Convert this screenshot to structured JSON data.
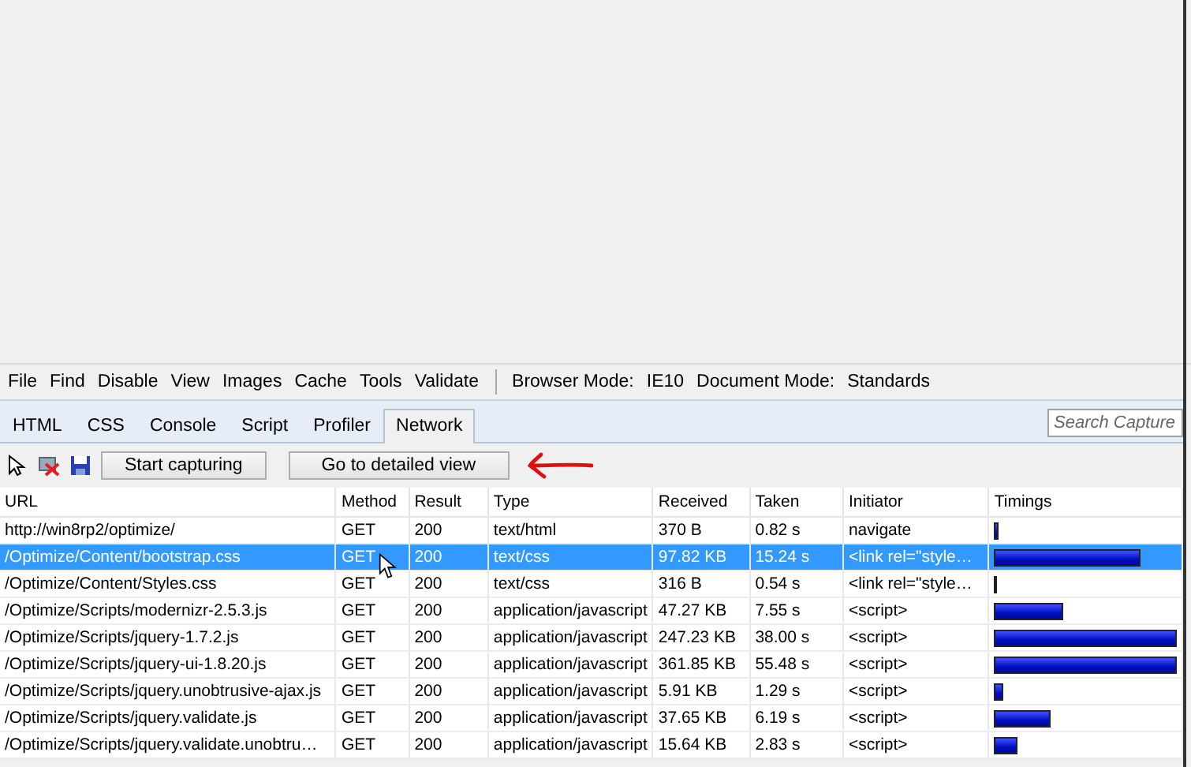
{
  "menu": [
    "File",
    "Find",
    "Disable",
    "View",
    "Images",
    "Cache",
    "Tools",
    "Validate"
  ],
  "modes": [
    {
      "label": "Browser Mode:",
      "value": "IE10"
    },
    {
      "label": "Document Mode:",
      "value": "Standards"
    }
  ],
  "tabs": [
    {
      "label": "HTML",
      "selected": false
    },
    {
      "label": "CSS",
      "selected": false
    },
    {
      "label": "Console",
      "selected": false
    },
    {
      "label": "Script",
      "selected": false
    },
    {
      "label": "Profiler",
      "selected": false
    },
    {
      "label": "Network",
      "selected": true
    }
  ],
  "search": {
    "placeholder": "Search Capture"
  },
  "toolbar": {
    "buttons": [
      "Start capturing",
      "Go to detailed view"
    ]
  },
  "table": {
    "columns": [
      "URL",
      "Method",
      "Result",
      "Type",
      "Received",
      "Taken",
      "Initiator",
      "Timings"
    ],
    "rows": [
      {
        "url": "http://win8rp2/optimize/",
        "method": "GET",
        "result": "200",
        "type": "text/html",
        "received": "370 B",
        "taken": "0.82 s",
        "initiator": "navigate",
        "level": 0.02,
        "selected": false
      },
      {
        "url": "/Optimize/Content/bootstrap.css",
        "method": "GET",
        "result": "200",
        "type": "text/css",
        "received": "97.82 KB",
        "taken": "15.24 s",
        "initiator": "<link rel=\"style…",
        "level": 0.8,
        "selected": true
      },
      {
        "url": "/Optimize/Content/Styles.css",
        "method": "GET",
        "result": "200",
        "type": "text/css",
        "received": "316 B",
        "taken": "0.54 s",
        "initiator": "<link rel=\"style…",
        "level": 0.01,
        "selected": false
      },
      {
        "url": "/Optimize/Scripts/modernizr-2.5.3.js",
        "method": "GET",
        "result": "200",
        "type": "application/javascript",
        "received": "47.27 KB",
        "taken": "7.55 s",
        "initiator": "<script>",
        "level": 0.38,
        "selected": false
      },
      {
        "url": "/Optimize/Scripts/jquery-1.7.2.js",
        "method": "GET",
        "result": "200",
        "type": "application/javascript",
        "received": "247.23 KB",
        "taken": "38.00 s",
        "initiator": "<script>",
        "level": 1,
        "selected": false
      },
      {
        "url": "/Optimize/Scripts/jquery-ui-1.8.20.js",
        "method": "GET",
        "result": "200",
        "type": "application/javascript",
        "received": "361.85 KB",
        "taken": "55.48 s",
        "initiator": "<script>",
        "level": 1,
        "selected": false
      },
      {
        "url": "/Optimize/Scripts/jquery.unobtrusive-ajax.js",
        "method": "GET",
        "result": "200",
        "type": "application/javascript",
        "received": "5.91 KB",
        "taken": "1.29 s",
        "initiator": "<script>",
        "level": 0.05,
        "selected": false
      },
      {
        "url": "/Optimize/Scripts/jquery.validate.js",
        "method": "GET",
        "result": "200",
        "type": "application/javascript",
        "received": "37.65 KB",
        "taken": "6.19 s",
        "initiator": "<script>",
        "level": 0.31,
        "selected": false
      },
      {
        "url": "/Optimize/Scripts/jquery.validate.unobtru…",
        "method": "GET",
        "result": "200",
        "type": "application/javascript",
        "received": "15.64 KB",
        "taken": "2.83 s",
        "initiator": "<script>",
        "level": 0.13,
        "selected": false
      }
    ]
  }
}
